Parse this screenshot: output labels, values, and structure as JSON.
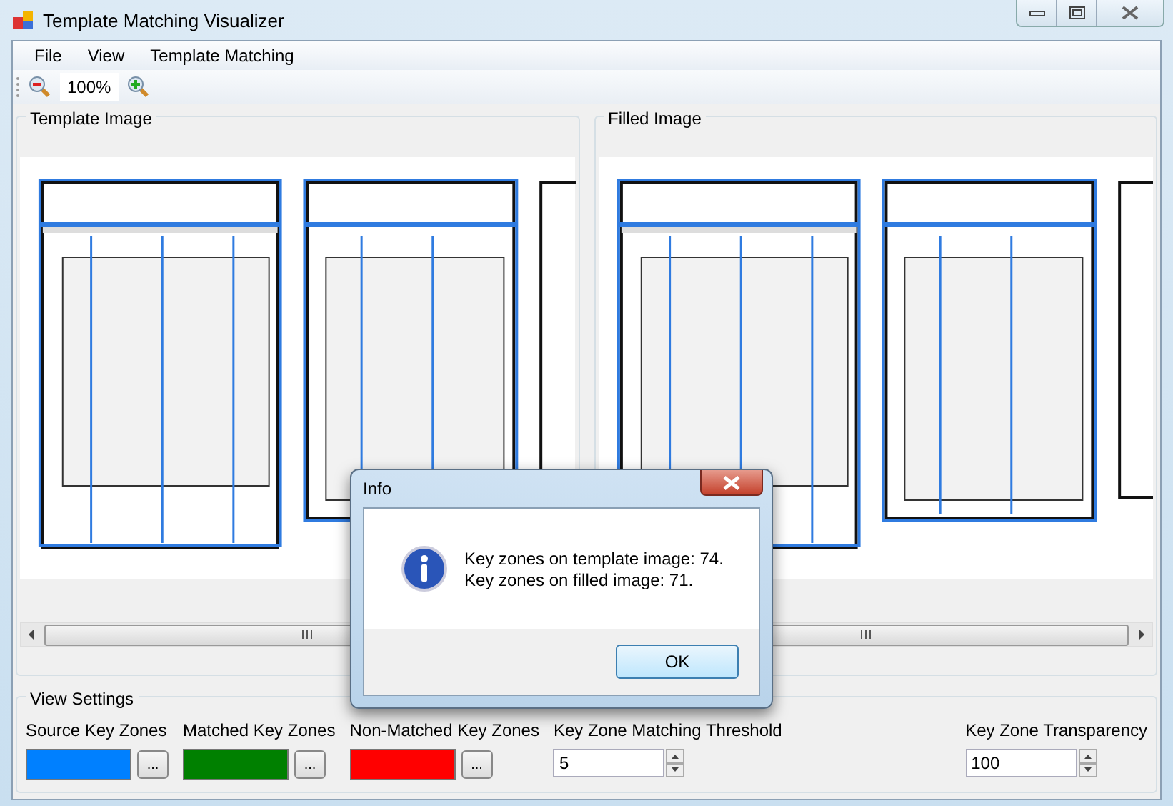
{
  "window": {
    "title": "Template Matching Visualizer"
  },
  "menu": [
    "File",
    "View",
    "Template Matching"
  ],
  "toolbar": {
    "zoom": "100%"
  },
  "panels": [
    {
      "title": "Template Image"
    },
    {
      "title": "Filled Image"
    }
  ],
  "view_settings": {
    "title": "View Settings",
    "colors": [
      {
        "label": "Source Key Zones",
        "color": "#0080ff",
        "button": "..."
      },
      {
        "label": "Matched Key Zones",
        "color": "#008000",
        "button": "..."
      },
      {
        "label": "Non-Matched Key Zones",
        "color": "#ff0000",
        "button": "..."
      }
    ],
    "threshold": {
      "label": "Key Zone Matching Threshold",
      "value": "5"
    },
    "transparency": {
      "label": "Key Zone Transparency",
      "value": "100"
    }
  },
  "dialog": {
    "title": "Info",
    "lines": [
      "Key zones on template image: 74.",
      "Key zones on filled image: 71."
    ],
    "button": "OK"
  }
}
